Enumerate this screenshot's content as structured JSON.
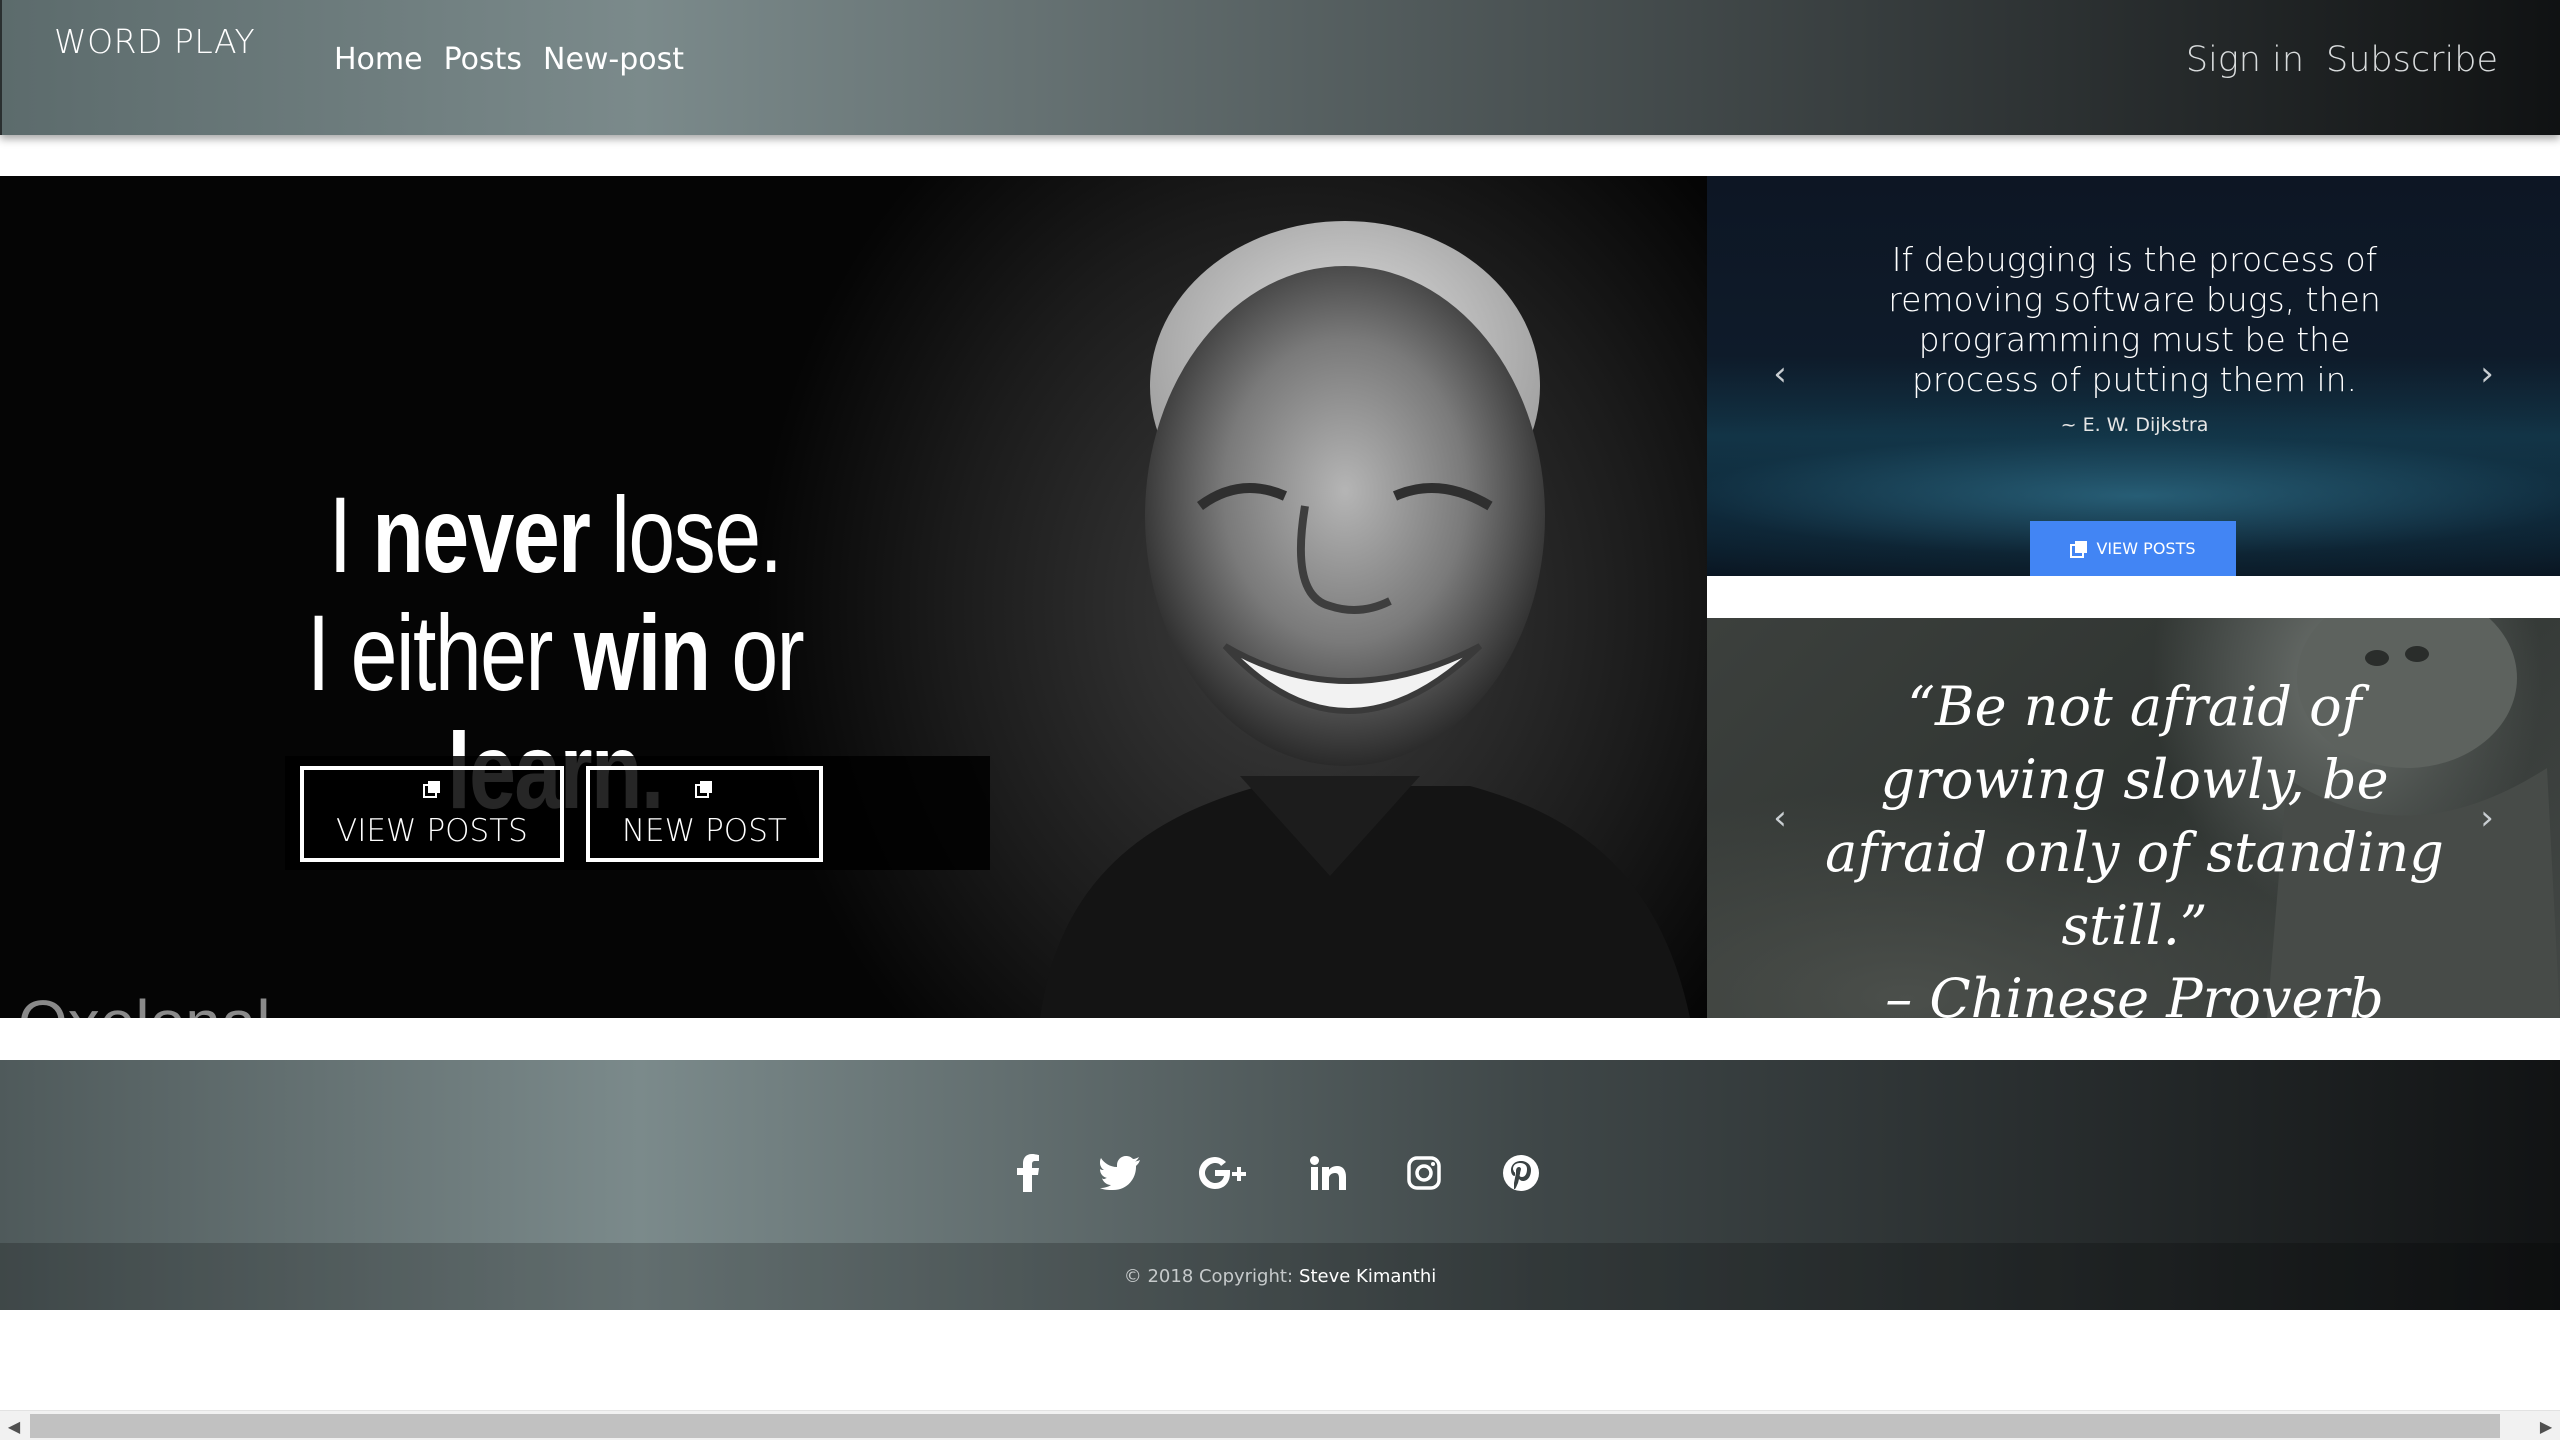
{
  "navbar": {
    "brand": "WORD PLAY",
    "links": [
      "Home",
      "Posts",
      "New-post"
    ],
    "right_links": [
      "Sign in",
      "Subscribe"
    ]
  },
  "hero": {
    "quote_line1_a": "I ",
    "quote_line1_b": "never",
    "quote_line1_c": " lose.",
    "quote_line2_a": "I either ",
    "quote_line2_b": "win",
    "quote_line2_c": " or ",
    "quote_line2_d": "learn.",
    "view_posts_label": "VIEW POSTS",
    "new_post_label": "NEW POST",
    "watermark": "Oxelonal"
  },
  "carousel_top": {
    "quote": "If debugging is the process of removing software bugs, then programming must be the process of putting them in.",
    "author": "~ E. W. Dijkstra",
    "button_label": "VIEW POSTS",
    "prev_icon": "chevron-left-icon",
    "next_icon": "chevron-right-icon"
  },
  "carousel_bottom": {
    "quote": "“Be not afraid of growing slowly, be afraid only of standing still.”",
    "author": "– Chinese Proverb"
  },
  "footer": {
    "socials": [
      "facebook-icon",
      "twitter-icon",
      "google-plus-icon",
      "linkedin-icon",
      "instagram-icon",
      "pinterest-icon"
    ],
    "copyright_text": "© 2018 Copyright:",
    "copyright_name": "Steve Kimanthi"
  },
  "colors": {
    "accent_blue": "#4285f4",
    "nav_gradient_start": "#7b8a8b",
    "nav_gradient_end": "#101213"
  }
}
